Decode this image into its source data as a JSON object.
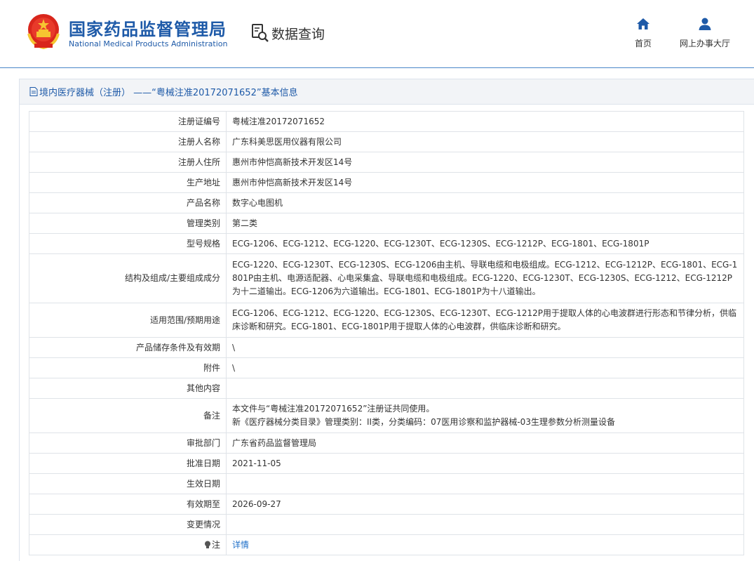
{
  "header": {
    "org_name_cn": "国家药品监督管理局",
    "org_name_en": "National Medical Products Administration",
    "query_label": "数据查询",
    "nav": [
      {
        "label": "首页",
        "icon": "home-icon"
      },
      {
        "label": "网上办事大厅",
        "icon": "user-icon"
      }
    ],
    "brand_color": "#1e5aa8"
  },
  "panel": {
    "title": "境内医疗器械（注册） ——“粤械注准20172071652”基本信息"
  },
  "rows": [
    {
      "label": "注册证编号",
      "value": "粤械注准20172071652"
    },
    {
      "label": "注册人名称",
      "value": "广东科美思医用仪器有限公司"
    },
    {
      "label": "注册人住所",
      "value": "惠州市仲恺高新技术开发区14号"
    },
    {
      "label": "生产地址",
      "value": "惠州市仲恺高新技术开发区14号"
    },
    {
      "label": "产品名称",
      "value": "数字心电图机"
    },
    {
      "label": "管理类别",
      "value": "第二类"
    },
    {
      "label": "型号规格",
      "value": "ECG-1206、ECG-1212、ECG-1220、ECG-1230T、ECG-1230S、ECG-1212P、ECG-1801、ECG-1801P"
    },
    {
      "label": "结构及组成/主要组成成分",
      "value": "ECG-1220、ECG-1230T、ECG-1230S、ECG-1206由主机、导联电缆和电极组成。ECG-1212、ECG-1212P、ECG-1801、ECG-1801P由主机、电源适配器、心电采集盒、导联电缆和电极组成。ECG-1220、ECG-1230T、ECG-1230S、ECG-1212、ECG-1212P为十二道输出。ECG-1206为六道输出。ECG-1801、ECG-1801P为十八道输出。"
    },
    {
      "label": "适用范围/预期用途",
      "value": "ECG-1206、ECG-1212、ECG-1220、ECG-1230S、ECG-1230T、ECG-1212P用于提取人体的心电波群进行形态和节律分析，供临床诊断和研究。ECG-1801、ECG-1801P用于提取人体的心电波群，供临床诊断和研究。"
    },
    {
      "label": "产品储存条件及有效期",
      "value": "\\"
    },
    {
      "label": "附件",
      "value": "\\"
    },
    {
      "label": "其他内容",
      "value": ""
    },
    {
      "label": "备注",
      "value_lines": [
        "本文件与“粤械注准20172071652”注册证共同使用。",
        "新《医疗器械分类目录》管理类别：II类，分类编码：07医用诊察和监护器械-03生理参数分析测量设备"
      ]
    },
    {
      "label": "审批部门",
      "value": "广东省药品监督管理局"
    },
    {
      "label": "批准日期",
      "value": "2021-11-05"
    },
    {
      "label": "生效日期",
      "value": ""
    },
    {
      "label": "有效期至",
      "value": "2026-09-27"
    },
    {
      "label": "变更情况",
      "value": ""
    },
    {
      "label": "注",
      "value": "详情",
      "icon": "lightbulb-icon"
    }
  ]
}
